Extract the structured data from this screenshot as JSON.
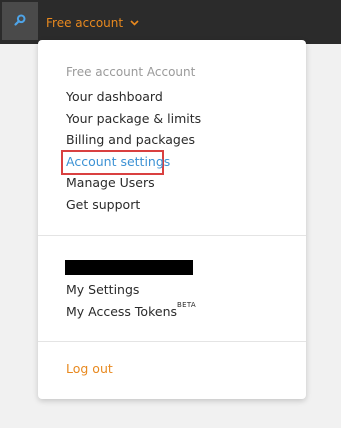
{
  "topbar": {
    "search_icon": "search-icon",
    "account_label": "Free account",
    "chevron_icon": "chevron-down-icon"
  },
  "dropdown": {
    "section_header": "Free account Account",
    "items": [
      {
        "label": "Your dashboard"
      },
      {
        "label": "Your package & limits"
      },
      {
        "label": "Billing and packages"
      },
      {
        "label": "Account settings"
      },
      {
        "label": "Manage Users"
      },
      {
        "label": "Get support"
      }
    ],
    "user_items": [
      {
        "label": "My Settings"
      },
      {
        "label": "My Access Tokens",
        "badge": "BETA"
      }
    ],
    "logout_label": "Log out"
  },
  "colors": {
    "topbar_bg": "#2b2b2b",
    "accent_orange": "#e8891f",
    "link_blue": "#3c92d4",
    "highlight_red": "#d94040"
  }
}
